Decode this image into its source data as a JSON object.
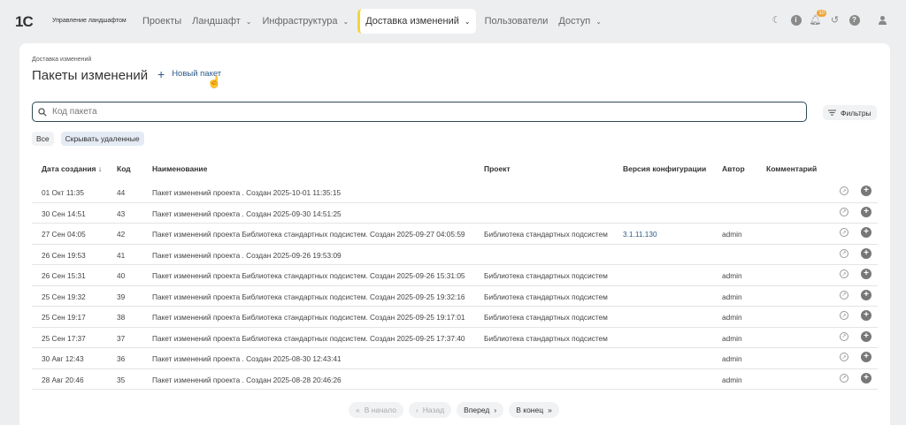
{
  "app": {
    "logo": "1С",
    "title": "Управление ландшафтом"
  },
  "nav": [
    {
      "label": "Проекты",
      "chevron": false,
      "active": false
    },
    {
      "label": "Ландшафт",
      "chevron": true,
      "active": false
    },
    {
      "label": "Инфраструктура",
      "chevron": true,
      "active": false
    },
    {
      "label": "Доставка изменений",
      "chevron": true,
      "active": true
    },
    {
      "label": "Пользователи",
      "chevron": false,
      "active": false
    },
    {
      "label": "Доступ",
      "chevron": true,
      "active": false
    }
  ],
  "top_icons": {
    "notification_count": "10"
  },
  "page": {
    "breadcrumb": "Доставка изменений",
    "title": "Пакеты изменений",
    "new_button": "Новый пакет"
  },
  "search": {
    "placeholder": "Код пакета",
    "value": ""
  },
  "filters_label": "Фильтры",
  "chips": [
    "Все",
    "Скрывать удаленные"
  ],
  "table": {
    "headers": {
      "date": "Дата создания ↓",
      "code": "Код",
      "name": "Наименование",
      "project": "Проект",
      "version": "Версия конфигурации",
      "author": "Автор",
      "comment": "Комментарий"
    },
    "rows": [
      {
        "date": "01 Окт 11:35",
        "code": "44",
        "name": "Пакет изменений проекта . Создан 2025-10-01 11:35:15",
        "project": "",
        "version": "",
        "author": "",
        "comment": ""
      },
      {
        "date": "30 Сен 14:51",
        "code": "43",
        "name": "Пакет изменений проекта . Создан 2025-09-30 14:51:25",
        "project": "",
        "version": "",
        "author": "",
        "comment": ""
      },
      {
        "date": "27 Сен 04:05",
        "code": "42",
        "name": "Пакет изменений проекта Библиотека стандартных подсистем. Создан 2025-09-27 04:05:59",
        "project": "Библиотека стандартных подсистем",
        "version": "3.1.11.130",
        "author": "admin",
        "comment": ""
      },
      {
        "date": "26 Сен 19:53",
        "code": "41",
        "name": "Пакет изменений проекта . Создан 2025-09-26 19:53:09",
        "project": "",
        "version": "",
        "author": "",
        "comment": ""
      },
      {
        "date": "26 Сен 15:31",
        "code": "40",
        "name": "Пакет изменений проекта Библиотека стандартных подсистем. Создан 2025-09-26 15:31:05",
        "project": "Библиотека стандартных подсистем",
        "version": "",
        "author": "admin",
        "comment": ""
      },
      {
        "date": "25 Сен 19:32",
        "code": "39",
        "name": "Пакет изменений проекта Библиотека стандартных подсистем. Создан 2025-09-25 19:32:16",
        "project": "Библиотека стандартных подсистем",
        "version": "",
        "author": "admin",
        "comment": ""
      },
      {
        "date": "25 Сен 19:17",
        "code": "38",
        "name": "Пакет изменений проекта Библиотека стандартных подсистем. Создан 2025-09-25 19:17:01",
        "project": "Библиотека стандартных подсистем",
        "version": "",
        "author": "admin",
        "comment": ""
      },
      {
        "date": "25 Сен 17:37",
        "code": "37",
        "name": "Пакет изменений проекта Библиотека стандартных подсистем. Создан 2025-09-25 17:37:40",
        "project": "Библиотека стандартных подсистем",
        "version": "",
        "author": "admin",
        "comment": ""
      },
      {
        "date": "30 Авг 12:43",
        "code": "36",
        "name": "Пакет изменений проекта . Создан 2025-08-30 12:43:41",
        "project": "",
        "version": "",
        "author": "admin",
        "comment": ""
      },
      {
        "date": "28 Авг 20:46",
        "code": "35",
        "name": "Пакет изменений проекта . Создан 2025-08-28 20:46:26",
        "project": "",
        "version": "",
        "author": "admin",
        "comment": ""
      }
    ]
  },
  "pager": {
    "first": "В начало",
    "prev": "Назад",
    "next": "Вперед",
    "last": "В конец"
  },
  "colors": {
    "accent": "#2a5a8a",
    "active_marker": "#f3d63a",
    "badge": "#f1a53a"
  }
}
